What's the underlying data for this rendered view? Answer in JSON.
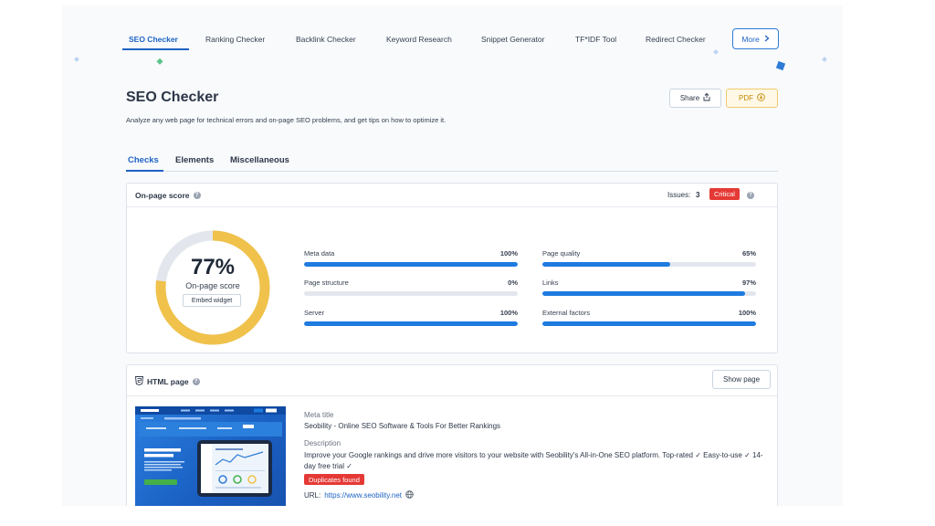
{
  "nav": {
    "tabs": [
      "SEO Checker",
      "Ranking Checker",
      "Backlink Checker",
      "Keyword Research",
      "Snippet Generator",
      "TF*IDF Tool",
      "Redirect Checker"
    ],
    "more_label": "More"
  },
  "header": {
    "title": "SEO Checker",
    "description": "Analyze any web page for technical errors and on-page SEO problems, and get tips on how to optimize it.",
    "share_label": "Share",
    "pdf_label": "PDF"
  },
  "tabs": [
    "Checks",
    "Elements",
    "Miscellaneous"
  ],
  "score_card": {
    "title": "On-page score",
    "issues_label": "Issues:",
    "issues_count": "3",
    "critical_label": "Critical",
    "score_value": 77,
    "score_text": "77%",
    "score_label": "On-page score",
    "embed_label": "Embed widget",
    "metrics": [
      {
        "label": "Meta data",
        "value": "100%",
        "fraction": 1.0
      },
      {
        "label": "Page quality",
        "value": "65%",
        "fraction": 0.6
      },
      {
        "label": "Page structure",
        "value": "0%",
        "fraction": 0.0
      },
      {
        "label": "Links",
        "value": "97%",
        "fraction": 0.95
      },
      {
        "label": "Server",
        "value": "100%",
        "fraction": 1.0
      },
      {
        "label": "External factors",
        "value": "100%",
        "fraction": 1.0
      }
    ]
  },
  "html_card": {
    "title": "HTML page",
    "show_label": "Show page",
    "meta_title_label": "Meta title",
    "meta_title": "Seobility - Online SEO Software & Tools For Better Rankings",
    "description_label": "Description",
    "description": "Improve your Google rankings and drive more visitors to your website with Seobility's All-in-One SEO platform. Top-rated ✓ Easy-to-use ✓ 14-day free trial ✓",
    "duplicates_label": "Duplicates found",
    "url_label": "URL:",
    "url": "https://www.seobility.net"
  },
  "colors": {
    "accent": "#1e63c4",
    "gauge": "#f0c24b",
    "gauge_track": "#e3e7ed",
    "critical": "#e53935"
  }
}
